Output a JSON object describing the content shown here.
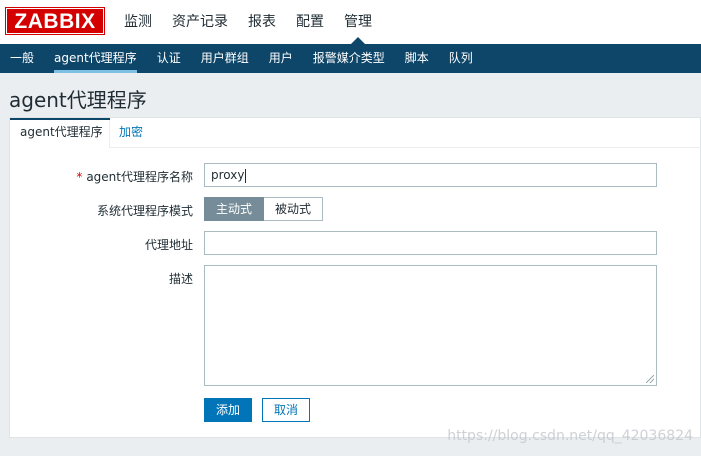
{
  "brand": {
    "logo_text": "ZABBIX",
    "logo_color": "#d40000"
  },
  "main_nav": [
    {
      "label": "监测"
    },
    {
      "label": "资产记录"
    },
    {
      "label": "报表"
    },
    {
      "label": "配置"
    },
    {
      "label": "管理",
      "active": true
    }
  ],
  "sub_nav": [
    {
      "label": "一般"
    },
    {
      "label": "agent代理程序",
      "active": true
    },
    {
      "label": "认证"
    },
    {
      "label": "用户群组"
    },
    {
      "label": "用户"
    },
    {
      "label": "报警媒介类型"
    },
    {
      "label": "脚本"
    },
    {
      "label": "队列"
    }
  ],
  "page": {
    "title": "agent代理程序"
  },
  "tabs": [
    {
      "label": "agent代理程序",
      "active": true
    },
    {
      "label": "加密"
    }
  ],
  "form": {
    "name": {
      "label": "agent代理程序名称",
      "required_mark": "*",
      "value": "proxy"
    },
    "mode": {
      "label": "系统代理程序模式",
      "options": [
        "主动式",
        "被动式"
      ],
      "selected": "主动式"
    },
    "address": {
      "label": "代理地址",
      "value": ""
    },
    "description": {
      "label": "描述",
      "value": ""
    }
  },
  "buttons": {
    "add": "添加",
    "cancel": "取消"
  },
  "watermark": "https://blog.csdn.net/qq_42036824",
  "colors": {
    "nav_bg": "#0e4669",
    "accent": "#0275b8",
    "segment_on": "#768d99"
  }
}
